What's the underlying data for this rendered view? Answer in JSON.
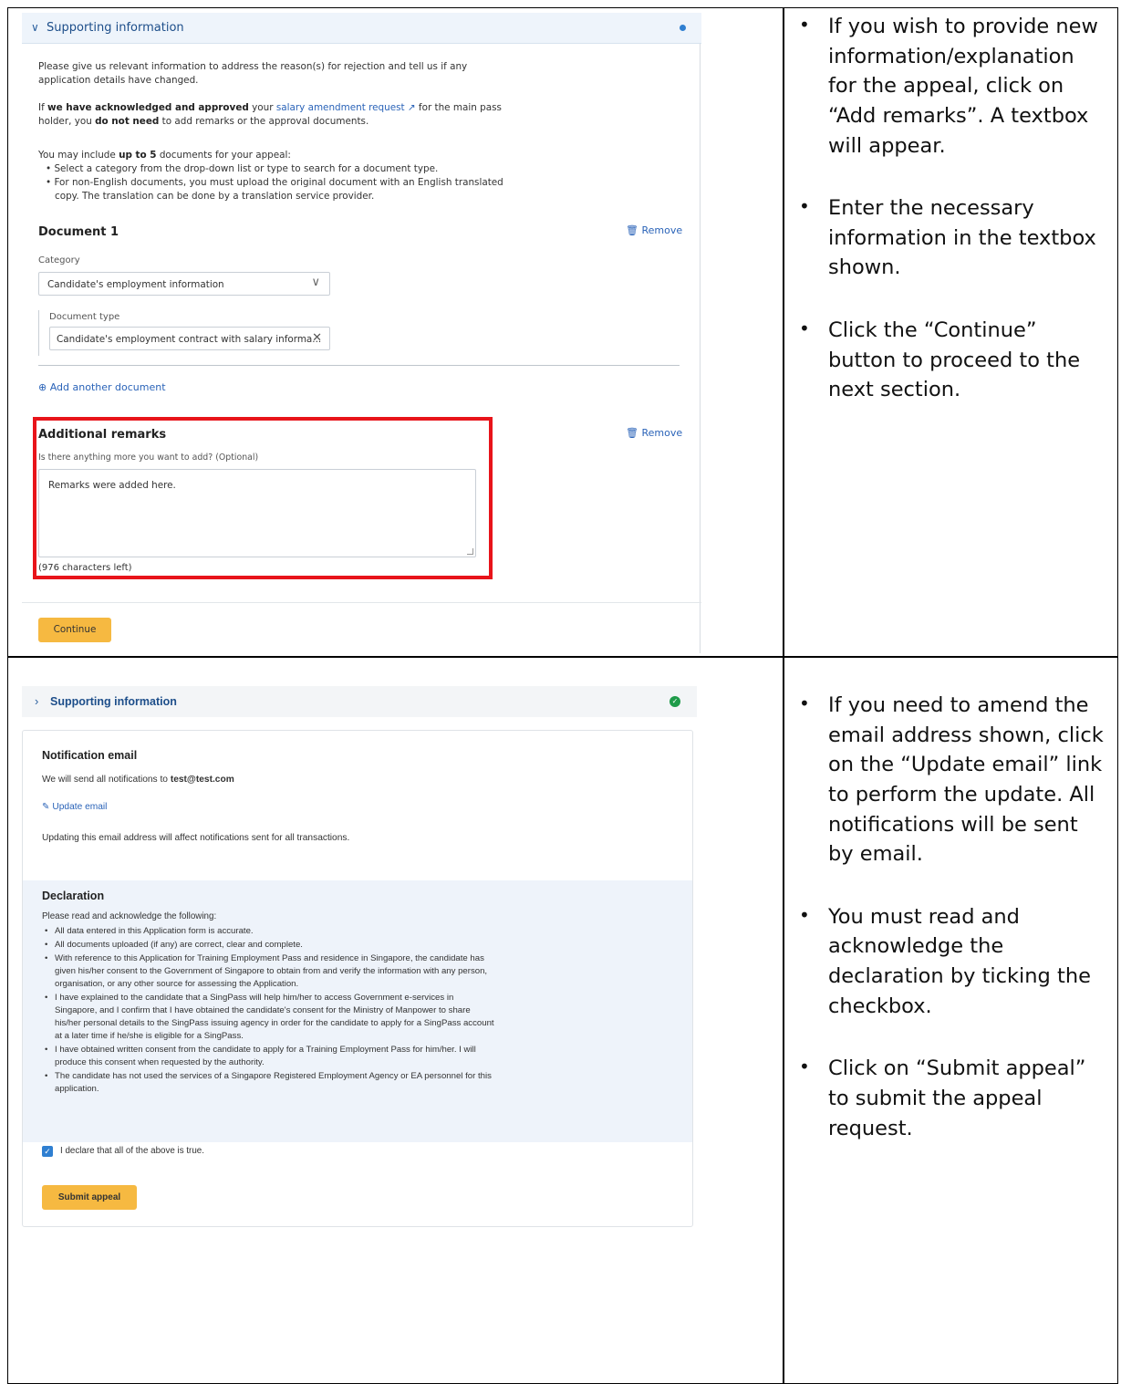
{
  "panel1": {
    "header_title": "Supporting information",
    "intro_line1": "Please give us relevant information to address the reason(s) for rejection and tell us if any",
    "intro_line2": "application details have changed.",
    "ack_if": "If ",
    "ack_bold": "we have acknowledged and approved",
    "ack_your": " your ",
    "ack_link": "salary amendment request",
    "ack_rest": " for the main pass",
    "ack_line2_pre": "holder, you ",
    "ack_line2_bold": "do not need",
    "ack_line2_post": " to add remarks or the approval documents.",
    "docs_pre": "You may include ",
    "docs_bold": "up to 5",
    "docs_post": " documents for your appeal:",
    "bullet1": "Select a category from the drop-down list or type to search for a document type.",
    "bullet2a": "For non-English documents, you must upload the original document with an English translated",
    "bullet2b": "copy. The translation can be done by a translation service provider.",
    "doc_title": "Document 1",
    "remove_label": "Remove",
    "category_label": "Category",
    "category_value": "Candidate's employment information",
    "doctype_label": "Document type",
    "doctype_value": "Candidate's employment contract with salary informa...",
    "add_document": "Add another document",
    "remarks_title": "Additional remarks",
    "remarks_question": "Is there anything more you want to add? (Optional)",
    "remarks_value": "Remarks were added here.",
    "chars_left": "(976 characters left)",
    "continue_label": "Continue"
  },
  "panel2": {
    "header_title": "Supporting information",
    "email_title": "Notification email",
    "email_pre": "We will send all notifications to ",
    "email_addr": "test@test.com",
    "update_email": "Update email",
    "update_note": "Updating this email address will affect notifications sent for all transactions.",
    "decl_title": "Declaration",
    "decl_intro": "Please read and acknowledge the following:",
    "decl_items": [
      "All data entered in this Application form is accurate.",
      "All documents uploaded (if any) are correct, clear and complete.",
      "With reference to this Application for Training Employment Pass and residence in Singapore, the candidate has given his/her consent to the Government of Singapore to obtain from and verify the information with any person, organisation, or any other source for assessing the Application.",
      "I have explained to the candidate that a SingPass will help him/her to access Government e-services in Singapore, and I confirm that I have obtained the candidate's consent for the Ministry of Manpower to share his/her personal details to the SingPass issuing agency in order for the candidate to apply for a SingPass account at a later time if he/she is eligible for a SingPass.",
      "I have obtained written consent from the candidate to apply for a Training Employment Pass for him/her. I will produce this consent when requested by the authority.",
      "The candidate has not used the services of a Singapore Registered Employment Agency or EA personnel for this application."
    ],
    "checkbox_label": "I declare that all of the above is true.",
    "submit_label": "Submit appeal"
  },
  "instructions1": [
    "If you wish to provide new information/explanation for the appeal, click on “Add remarks”. A textbox will appear.",
    "Enter the necessary information in the textbox shown.",
    "Click the “Continue” button to proceed to the next section."
  ],
  "instructions2": [
    "If you need to amend the email address shown, click on the “Update email” link to perform the update. All notifications will be sent by email.",
    "You must read and acknowledge the declaration by ticking the checkbox.",
    "Click on “Submit appeal” to submit the appeal request."
  ],
  "colors": {
    "accent_button": "#f6b941",
    "link": "#2a63b8",
    "highlight_box": "#e8141a",
    "success": "#1e9b49"
  }
}
